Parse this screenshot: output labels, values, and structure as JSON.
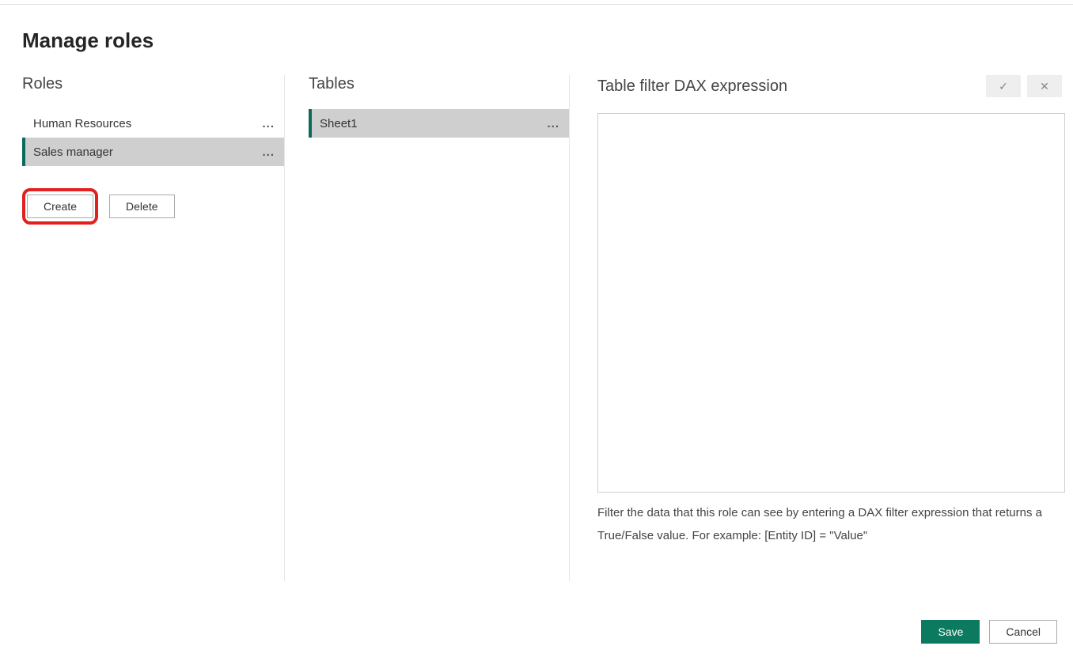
{
  "title": "Manage roles",
  "columns": {
    "roles": {
      "header": "Roles",
      "items": [
        {
          "label": "Human Resources",
          "selected": false
        },
        {
          "label": "Sales manager",
          "selected": true
        }
      ],
      "create_label": "Create",
      "delete_label": "Delete"
    },
    "tables": {
      "header": "Tables",
      "items": [
        {
          "label": "Sheet1",
          "selected": true
        }
      ]
    },
    "dax": {
      "header": "Table filter DAX expression",
      "check_icon": "✓",
      "close_icon": "✕",
      "editor_value": "",
      "help_text": "Filter the data that this role can see by entering a DAX filter expression that returns a True/False value. For example: [Entity ID] = \"Value\""
    }
  },
  "footer": {
    "save_label": "Save",
    "cancel_label": "Cancel"
  }
}
